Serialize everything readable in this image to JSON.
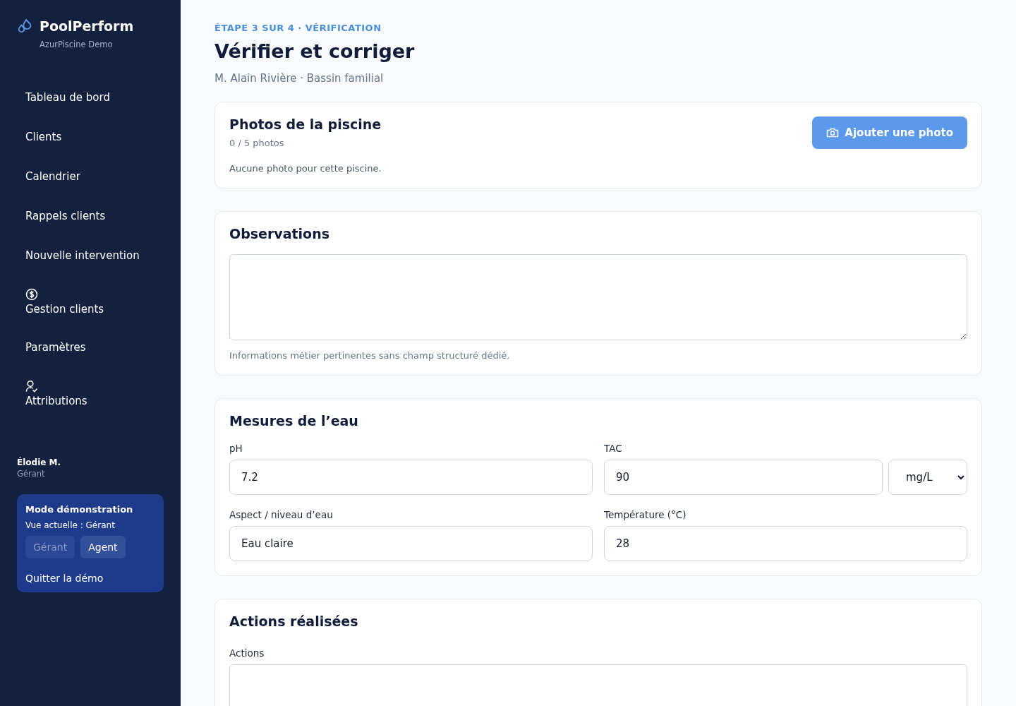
{
  "brand": {
    "name": "PoolPerform",
    "subtitle": "AzurPiscine Demo"
  },
  "nav": [
    {
      "label": "Tableau de bord",
      "kind": "plain"
    },
    {
      "label": "Clients",
      "kind": "plain"
    },
    {
      "label": "Calendrier",
      "kind": "plain"
    },
    {
      "label": "Rappels clients",
      "kind": "plain"
    },
    {
      "label": "Nouvelle intervention",
      "kind": "plain"
    },
    {
      "label": "Gestion clients",
      "kind": "money"
    },
    {
      "label": "Paramètres",
      "kind": "plain"
    },
    {
      "label": "Attributions",
      "kind": "person"
    }
  ],
  "user": {
    "name": "Élodie M.",
    "role": "Gérant"
  },
  "demo": {
    "title": "Mode démonstration",
    "current_view": "Vue actuelle : Gérant",
    "roles": [
      {
        "label": "Gérant",
        "selected": true
      },
      {
        "label": "Agent",
        "selected": false
      }
    ],
    "quit": "Quitter la démo"
  },
  "header": {
    "step": "ÉTAPE 3 SUR 4 · VÉRIFICATION",
    "title": "Vérifier et corriger",
    "subtitle": "M. Alain Rivière · Bassin familial"
  },
  "photos": {
    "title": "Photos de la piscine",
    "count": "0 / 5 photos",
    "empty": "Aucune photo pour cette piscine.",
    "button": "Ajouter une photo"
  },
  "observations": {
    "title": "Observations",
    "help": "Informations métier pertinentes sans champ structuré dédié."
  },
  "measures": {
    "title": "Mesures de l’eau",
    "fields": [
      {
        "label": "pH",
        "value": "7.2"
      },
      {
        "label": "TAC",
        "value": "90",
        "unit": "mg/L"
      },
      {
        "label": "Aspect / niveau d’eau",
        "value": "Eau claire"
      },
      {
        "label": "Température (°C)",
        "value": "28"
      }
    ]
  },
  "actions": {
    "title": "Actions réalisées",
    "label": "Actions"
  }
}
